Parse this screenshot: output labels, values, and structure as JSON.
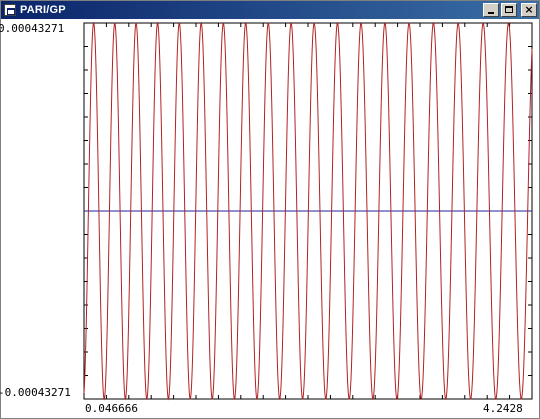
{
  "window": {
    "title": "PARI/GP",
    "icon": "app-window-icon",
    "controls": [
      "minimize",
      "maximize",
      "close"
    ],
    "close_glyph": "×"
  },
  "plot": {
    "y_max_label": "0.00043271",
    "y_min_label": "-0.00043271",
    "x_min_label": "0.046666",
    "x_max_label": "4.2428"
  },
  "chart_data": {
    "type": "line",
    "xlim": [
      0.046666,
      4.2428
    ],
    "ylim": [
      -0.00043271,
      0.00043271
    ],
    "grid": false,
    "curve_color": "#b22222",
    "axis_color": "#2020a0",
    "x_axis_at_y": 0
  }
}
